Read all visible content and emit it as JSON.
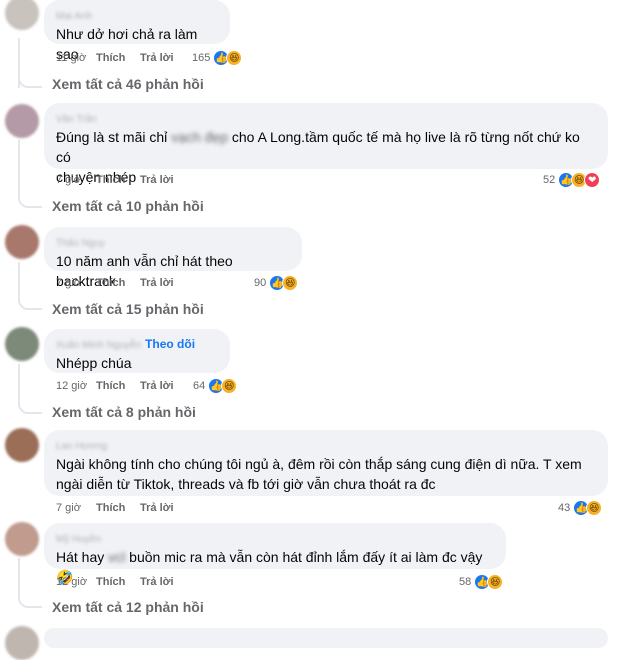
{
  "comments": [
    {
      "author": "Mai Anh",
      "text": "Như dở hơi chả ra làm sao",
      "time": "11 giờ",
      "like": "Thích",
      "reply": "Trả lời",
      "count": "165",
      "view_all": "Xem tất cả 46 phản hồi"
    },
    {
      "author": "Vân Trần",
      "text_a": "Đúng là st mãi chỉ ",
      "text_blur": "vạch đẹp",
      "text_b": " cho A Long.tầm quốc tế mà họ live là rõ từng nốt chứ ko có",
      "text_line2": "chuyện nhép",
      "time": "7 giờ",
      "like": "Thích",
      "reply": "Trả lời",
      "count": "52",
      "view_all": "Xem tất cả 10 phản hồi"
    },
    {
      "author": "Thảo Nguy",
      "text": "10 năm anh vẫn chỉ hát theo backtrack",
      "time": "7 giờ",
      "like": "Thích",
      "reply": "Trả lời",
      "count": "90",
      "view_all": "Xem tất cả 15 phản hồi"
    },
    {
      "author": "Xuân Minh Nguyễn",
      "follow": "Theo dõi",
      "text": "Nhépp chúa",
      "time": "12 giờ",
      "like": "Thích",
      "reply": "Trả lời",
      "count": "64",
      "view_all": "Xem tất cả 8 phản hồi"
    },
    {
      "author": "Lan Hương",
      "text": "Ngài không tính cho chúng tôi ngủ à, đêm rồi còn thắp sáng cung điện dì nữa. T xem",
      "text_line2": "ngài diễn từ Tiktok, threads và fb tới giờ vẫn chưa thoát ra đc",
      "time": "7 giờ",
      "like": "Thích",
      "reply": "Trả lời",
      "count": "43"
    },
    {
      "author": "Mỹ Huyền",
      "text_a": "Hát hay ",
      "text_blur": "vcl",
      "text_b": " buồn mic ra mà vẫn còn hát đỉnh lắm đấy ít ai làm đc vậy",
      "emoji": "🤣",
      "time": "12 giờ",
      "like": "Thích",
      "reply": "Trả lời",
      "count": "58",
      "view_all": "Xem tất cả 12 phản hồi"
    }
  ],
  "icons": {
    "like": "👍",
    "haha": "😆",
    "love": "❤"
  },
  "colors": {
    "bubble": "#f0f2f5",
    "secondary": "#65676b",
    "link": "#1877f2"
  }
}
